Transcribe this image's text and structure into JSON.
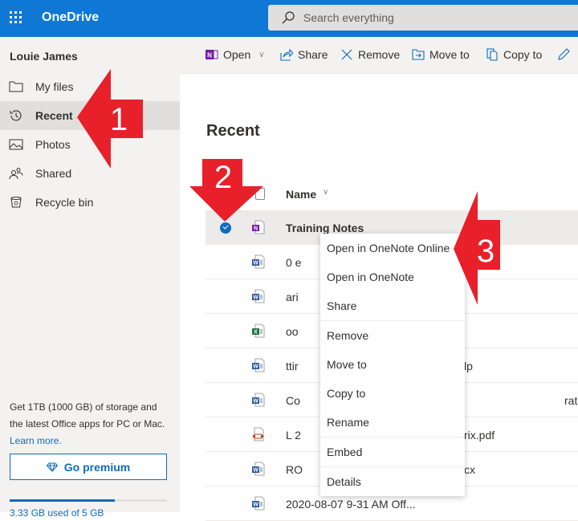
{
  "header": {
    "app_name": "OneDrive",
    "search_placeholder": "Search everything"
  },
  "sidebar": {
    "user_name": "Louie James",
    "items": [
      {
        "label": "My files",
        "icon": "folder-icon",
        "active": false
      },
      {
        "label": "Recent",
        "icon": "history-icon",
        "active": true
      },
      {
        "label": "Photos",
        "icon": "image-icon",
        "active": false
      },
      {
        "label": "Shared",
        "icon": "people-icon",
        "active": false
      },
      {
        "label": "Recycle bin",
        "icon": "recycle-bin-icon",
        "active": false
      }
    ],
    "promo_text": "Get 1TB (1000 GB) of storage and the latest Office apps for PC or Mac.",
    "learn_more": "Learn more.",
    "premium_button": "Go premium",
    "storage_fraction": 0.67,
    "storage_text": "3.33 GB used of 5 GB"
  },
  "toolbar": {
    "open": "Open",
    "share": "Share",
    "remove": "Remove",
    "move_to": "Move to",
    "copy_to": "Copy to"
  },
  "main": {
    "title": "Recent",
    "column_name": "Name",
    "files": [
      {
        "name": "Training Notes",
        "type": "onenote",
        "selected": true
      },
      {
        "name": "0 e",
        "type": "word",
        "selected": false
      },
      {
        "name": "ari",
        "type": "word",
        "selected": false
      },
      {
        "name": "oo",
        "type": "excel",
        "selected": false
      },
      {
        "name": "ttir",
        "type": "word",
        "selected": false
      },
      {
        "name": "Co",
        "type": "word",
        "selected": false
      },
      {
        "name": "L 2",
        "type": "pdf",
        "selected": false
      },
      {
        "name": "RO",
        "type": "word",
        "selected": false
      },
      {
        "name": "2020-08-07 9-31 AM Off...",
        "type": "word",
        "selected": false
      }
    ],
    "file_name_tails": {
      "ttir": "lp",
      "Co": "ration",
      "L 2": "rix.pdf",
      "RO": "cx"
    }
  },
  "context_menu": {
    "items": [
      "Open in OneNote Online",
      "Open in OneNote",
      "Share",
      "Remove",
      "Move to",
      "Copy to",
      "Rename",
      "Embed",
      "Details"
    ]
  },
  "annotations": {
    "step1": "1",
    "step2": "2",
    "step3": "3",
    "color": "#e8202a"
  },
  "colors": {
    "brand_blue": "#0f78d4",
    "link_blue": "#0f6cbd",
    "onenote_purple": "#7719aa",
    "word_blue": "#2b579a",
    "excel_green": "#217346",
    "pdf_red": "#c43e1c"
  }
}
